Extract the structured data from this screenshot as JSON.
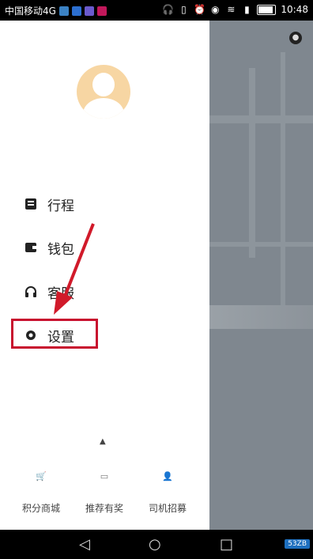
{
  "status_bar": {
    "carrier": "中国移动4G",
    "time": "10:48",
    "notif_colors": [
      "#3b82c4",
      "#2c6fd1",
      "#6a5acd",
      "#c2185b"
    ]
  },
  "menu": {
    "items": [
      {
        "label": "行程",
        "icon": "trip-icon"
      },
      {
        "label": "钱包",
        "icon": "wallet-icon"
      },
      {
        "label": "客服",
        "icon": "headset-icon"
      },
      {
        "label": "设置",
        "icon": "gear-icon"
      }
    ]
  },
  "shortcuts": [
    {
      "label": "积分商城",
      "icon": "cart-icon"
    },
    {
      "label": "推荐有奖",
      "icon": "card-icon"
    },
    {
      "label": "司机招募",
      "icon": "driver-icon"
    }
  ],
  "watermark": "53ZB"
}
